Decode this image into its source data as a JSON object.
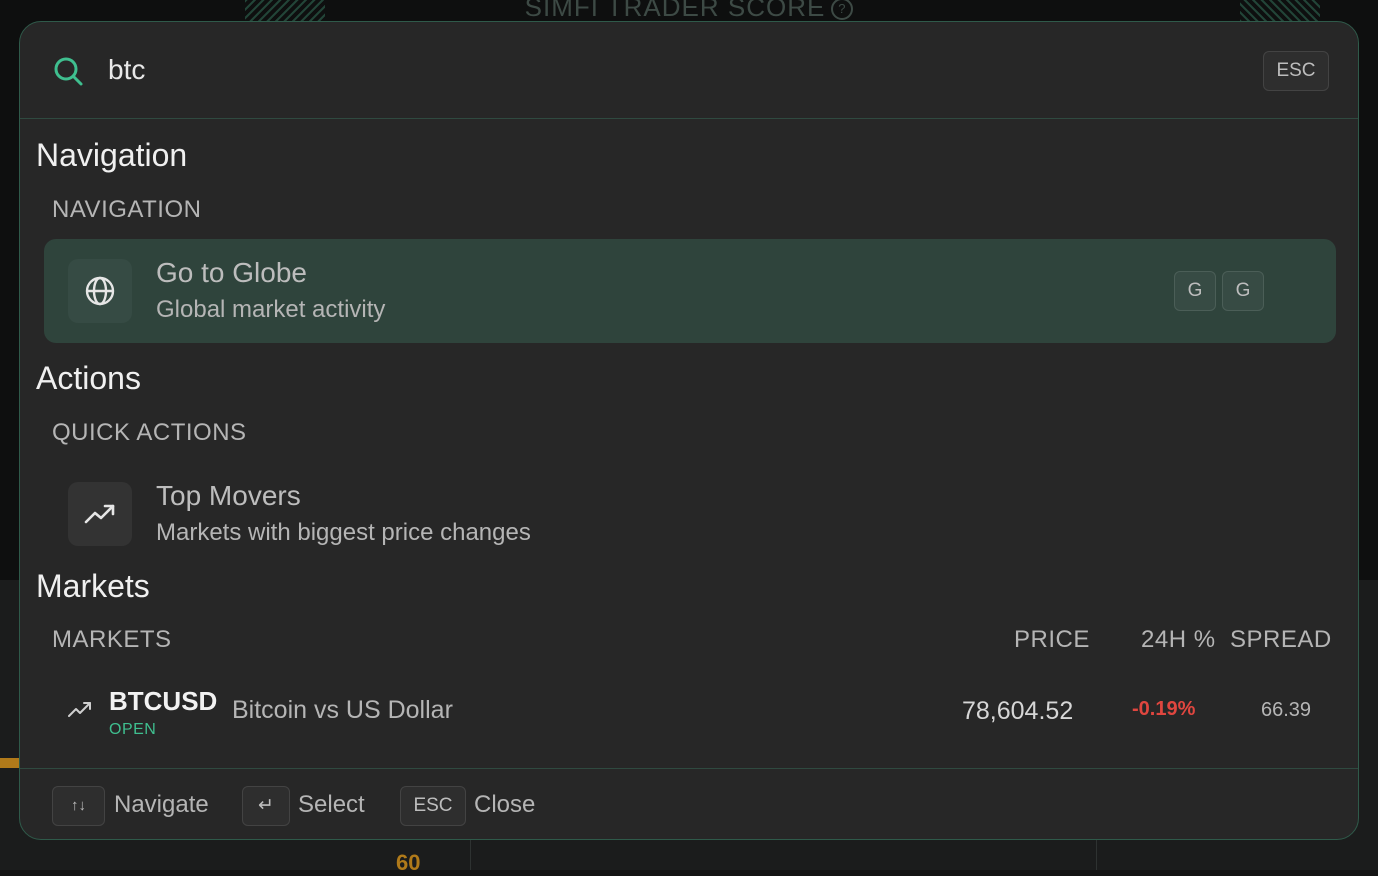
{
  "background": {
    "score_title": "SIMFI TRADER SCORE",
    "score_help": "?",
    "number": "60"
  },
  "search": {
    "value": "btc",
    "esc_key": "ESC"
  },
  "groups": {
    "navigation": {
      "title": "Navigation",
      "subtitle": "NAVIGATION",
      "items": [
        {
          "title": "Go to Globe",
          "description": "Global market activity",
          "icon": "globe-icon",
          "shortcut": [
            "G",
            "G"
          ],
          "active": true
        }
      ]
    },
    "actions": {
      "title": "Actions",
      "subtitle": "QUICK ACTIONS",
      "items": [
        {
          "title": "Top Movers",
          "description": "Markets with biggest price changes",
          "icon": "trending-up-icon"
        }
      ]
    },
    "markets": {
      "title": "Markets",
      "columns": {
        "markets": "MARKETS",
        "price": "PRICE",
        "change": "24H %",
        "spread": "SPREAD"
      },
      "rows": [
        {
          "ticker": "BTCUSD",
          "status": "OPEN",
          "name": "Bitcoin vs US Dollar",
          "price": "78,604.52",
          "change": "-0.19%",
          "spread": "66.39"
        }
      ]
    }
  },
  "footer": {
    "navigate_key": "↑↓",
    "navigate_label": "Navigate",
    "select_key": "↵",
    "select_label": "Select",
    "close_key": "ESC",
    "close_label": "Close"
  },
  "colors": {
    "accent": "#3fbf8f",
    "negative": "#e0463f",
    "panel": "#272727",
    "active_row": "#2f443c"
  }
}
